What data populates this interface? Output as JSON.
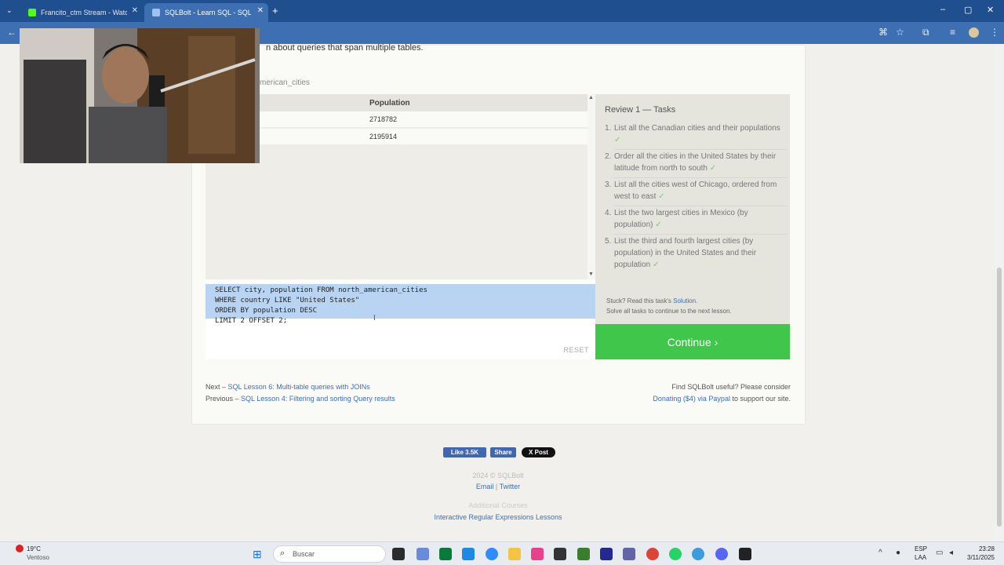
{
  "browser": {
    "tabs": [
      {
        "label": "Francito_ctm Stream - Watch Li",
        "active": false
      },
      {
        "label": "SQLBolt - Learn SQL - SQL Revi",
        "active": true
      }
    ],
    "new_tab": "+",
    "window_controls": [
      "–",
      "▢",
      "✕"
    ]
  },
  "lesson": {
    "intro_tail": "n about queries that span multiple tables.",
    "table_title": "merican_cities",
    "column_header": "Population",
    "rows": [
      "2718782",
      "2195914"
    ]
  },
  "editor": {
    "lines": [
      "SELECT city, population FROM north_american_cities",
      "WHERE country LIKE \"United States\"",
      "ORDER BY population DESC",
      "LIMIT 2 OFFSET 2;"
    ],
    "reset_label": "RESET"
  },
  "tasks": {
    "heading": "Review 1 — Tasks",
    "items": [
      {
        "num": "1.",
        "text": "List all the Canadian cities and their populations"
      },
      {
        "num": "2.",
        "text": "Order all the cities in the United States by their latitude from north to south"
      },
      {
        "num": "3.",
        "text": "List all the cities west of Chicago, ordered from west to east"
      },
      {
        "num": "4.",
        "text": "List the two largest cities in Mexico (by population)"
      },
      {
        "num": "5.",
        "text": "List the third and fourth largest cities (by population) in the United States and their population"
      }
    ],
    "check": "✓",
    "stuck_prefix": "Stuck? Read this task's ",
    "solution_link": "Solution.",
    "solve_note": "Solve all tasks to continue to the next lesson.",
    "continue_label": "Continue ›"
  },
  "navigation": {
    "next_prefix": "Next – ",
    "next_link": "SQL Lesson 6: Multi-table queries with JOINs",
    "prev_prefix": "Previous – ",
    "prev_link": "SQL Lesson 4: Filtering and sorting Query results",
    "support_text": "Find SQLBolt useful? Please consider",
    "donate_link": "Donating ($4) via Paypal",
    "support_tail": " to support our site."
  },
  "footer": {
    "like_label": "Like 3.5K",
    "share_label": "Share",
    "post_label": "X Post",
    "copyright": "2024 © SQLBolt",
    "email": "Email",
    "divider": "|",
    "twitter": "Twitter",
    "additional": "Additional Courses",
    "regex_link": "Interactive Regular Expressions Lessons"
  },
  "taskbar": {
    "weather_temp": "19°C",
    "weather_desc": "Ventoso",
    "search_placeholder": "Buscar",
    "lang": "ESP",
    "lang_sub": "LAA",
    "time": "23:28",
    "date": "3/11/2025"
  },
  "colors": {
    "tab_bar": "#1f4f8f",
    "continue": "#3fc64b",
    "selection": "#b9d3f3",
    "link": "#3a6fb7"
  }
}
